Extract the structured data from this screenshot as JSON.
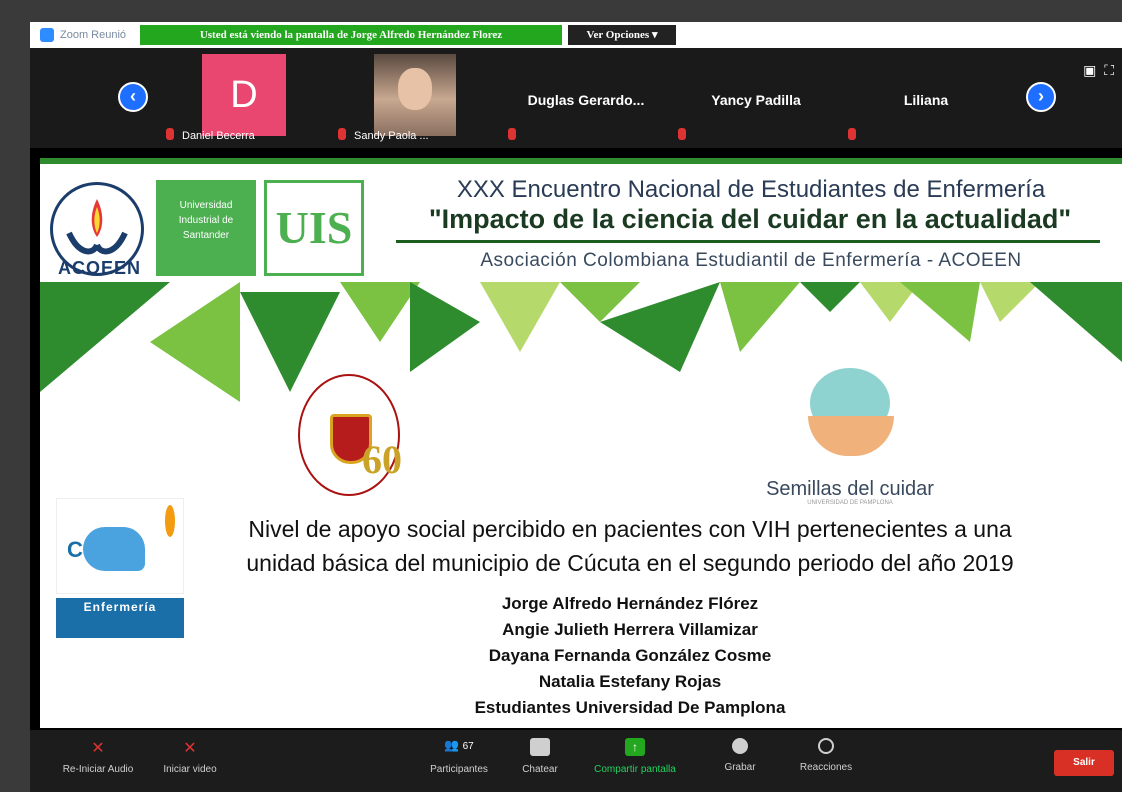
{
  "window": {
    "app_title": "Zoom Reunió",
    "viewing_banner": "Usted está viendo la pantalla de Jorge Alfredo Hernández Florez",
    "view_options": "Ver Opciones"
  },
  "participants": [
    {
      "name": "Daniel Becerra",
      "avatar_letter": "D"
    },
    {
      "name": "Sandy Paola ..."
    },
    {
      "name": "Duglas Gerardo..."
    },
    {
      "name": "Yancy Padilla"
    },
    {
      "name": "Liliana"
    }
  ],
  "slide": {
    "acoeen_logo_text": "ACOEEN",
    "uis_box_text": "Universidad Industrial de Santander",
    "uis_logo": "UIS",
    "title_line1": "XXX Encuentro Nacional  de Estudiantes de Enfermería",
    "title_line2": "\"Impacto de la ciencia del cuidar en la actualidad\"",
    "title_line3": "Asociación Colombiana Estudiantil de Enfermería - ACOEEN",
    "sixty": "60",
    "semillas_title": "Semillas del cuidar",
    "semillas_sub": "UNIVERSIDAD DE PAMPLONA",
    "enfermeria_label": "Enfermería",
    "paper_title_line1": "Nivel de apoyo social percibido en pacientes con VIH pertenecientes a una",
    "paper_title_line2": "unidad básica del municipio de Cúcuta en el segundo periodo del año 2019",
    "authors": [
      "Jorge Alfredo Hernández Flórez",
      "Angie Julieth Herrera Villamizar",
      "Dayana Fernanda González Cosme",
      "Natalia Estefany Rojas",
      "Estudiantes Universidad De Pamplona"
    ]
  },
  "toolbar": {
    "audio": "Re-Iniciar Audio",
    "video": "Iniciar video",
    "participants": "Participantes",
    "participants_count": "67",
    "chat": "Chatear",
    "share": "Compartir pantalla",
    "record": "Grabar",
    "reactions": "Reacciones",
    "leave": "Salir"
  }
}
